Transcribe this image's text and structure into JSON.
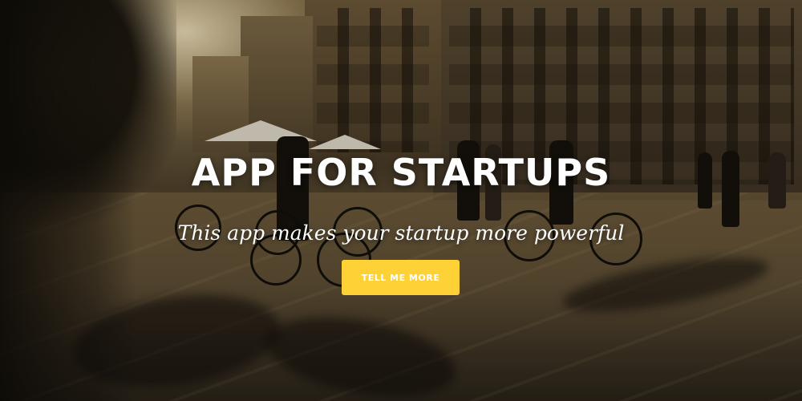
{
  "hero": {
    "headline": "APP FOR STARTUPS",
    "subheading": "This app makes your startup more powerful",
    "cta_label": "TELL ME MORE",
    "background_description_icon": "street-photo-background"
  },
  "colors": {
    "cta_background": "#fed136",
    "cta_text": "#ffffff",
    "headline_text": "#ffffff"
  }
}
